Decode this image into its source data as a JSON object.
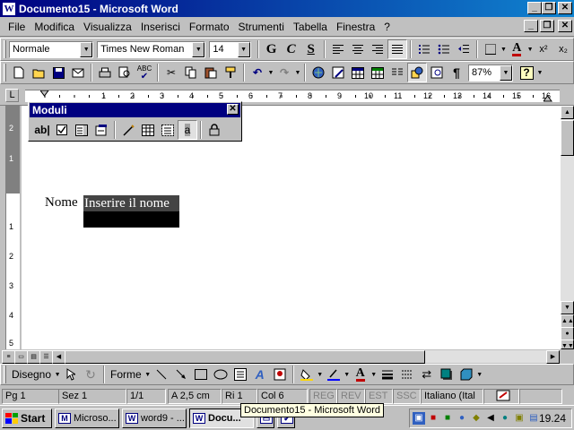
{
  "window": {
    "title": "Documento15 - Microsoft Word",
    "app_icon": "W",
    "controls": {
      "minimize": "_",
      "restore": "❐",
      "close": "✕"
    }
  },
  "menu": {
    "items": [
      "File",
      "Modifica",
      "Visualizza",
      "Inserisci",
      "Formato",
      "Strumenti",
      "Tabella",
      "Finestra",
      "?"
    ]
  },
  "format_toolbar": {
    "style": "Normale",
    "font": "Times New Roman",
    "size": "14",
    "bold": "G",
    "italic": "C",
    "underline": "S",
    "font_color_letter": "A",
    "accent": "#c00000"
  },
  "standard_toolbar": {
    "zoom": "87%",
    "pilcrow": "¶",
    "help": "?"
  },
  "ruler": {
    "tab_selector": "L",
    "ticks": [
      "1",
      "2",
      "3",
      "4",
      "5",
      "6",
      "7",
      "8",
      "9",
      "10",
      "11",
      "12",
      "13",
      "14",
      "15",
      "16"
    ],
    "vticks": [
      "2",
      "1",
      "1",
      "2",
      "3",
      "4",
      "5"
    ]
  },
  "document": {
    "label": "Nome",
    "field_text": "Inserire il nome"
  },
  "moduli_toolbar": {
    "title": "Moduli",
    "close": "✕",
    "tools": [
      "text-field",
      "check-box",
      "drop-down-field",
      "form-field-options",
      "draw-table",
      "insert-table",
      "insert-frame",
      "form-field-shading",
      "protect-form"
    ],
    "text_field_label": "ab|"
  },
  "drawing_toolbar": {
    "draw_label": "Disegno",
    "shapes_label": "Forme"
  },
  "status_bar": {
    "page": "Pg 1",
    "section": "Sez 1",
    "pages": "1/1",
    "at": "A  2,5 cm",
    "line": "Ri  1",
    "col": "Col  6",
    "rec": "REG",
    "trk": "REV",
    "ext": "EST",
    "ovr": "SSC",
    "language": "Italiano (Ital"
  },
  "taskbar": {
    "start": "Start",
    "tasks": [
      {
        "label": "Microso...",
        "icon": "M"
      },
      {
        "label": "word9 - ...",
        "icon": "W"
      },
      {
        "label": "Docu...",
        "icon": "W"
      }
    ],
    "tooltip": "Documento15 - Microsoft Word",
    "clock": "19.24",
    "flag_colors": [
      "#ff0000",
      "#00a000",
      "#0000ff",
      "#ffcc00"
    ]
  }
}
